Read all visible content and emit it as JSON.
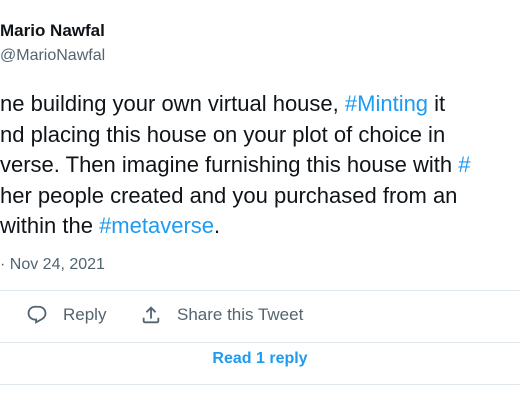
{
  "author": {
    "name": "Mario Nawfal",
    "handle": "@MarioNawfal"
  },
  "tweet": {
    "lines": [
      [
        {
          "text": "ne building your own virtual house, ",
          "type": "text"
        },
        {
          "text": "#Minting",
          "type": "hashtag"
        },
        {
          "text": " it",
          "type": "text"
        }
      ],
      [
        {
          "text": "nd placing this house on your plot of choice in",
          "type": "text"
        }
      ],
      [
        {
          "text": "verse. Then imagine furnishing this house with ",
          "type": "text"
        },
        {
          "text": "#",
          "type": "hashtag"
        }
      ],
      [
        {
          "text": "her people created and you purchased from an",
          "type": "text"
        }
      ],
      [
        {
          "text": "within the ",
          "type": "text"
        },
        {
          "text": "#metaverse",
          "type": "hashtag"
        },
        {
          "text": ".",
          "type": "text"
        }
      ]
    ],
    "timestamp": "· Nov 24, 2021"
  },
  "actions": {
    "reply_label": "Reply",
    "share_label": "Share this Tweet"
  },
  "read_replies_label": "Read 1 reply",
  "colors": {
    "text": "#0f1419",
    "secondary": "#536471",
    "accent": "#1d9bf0",
    "divider": "#e1e8ed"
  },
  "icons": {
    "reply": "reply-icon",
    "share": "share-icon"
  }
}
